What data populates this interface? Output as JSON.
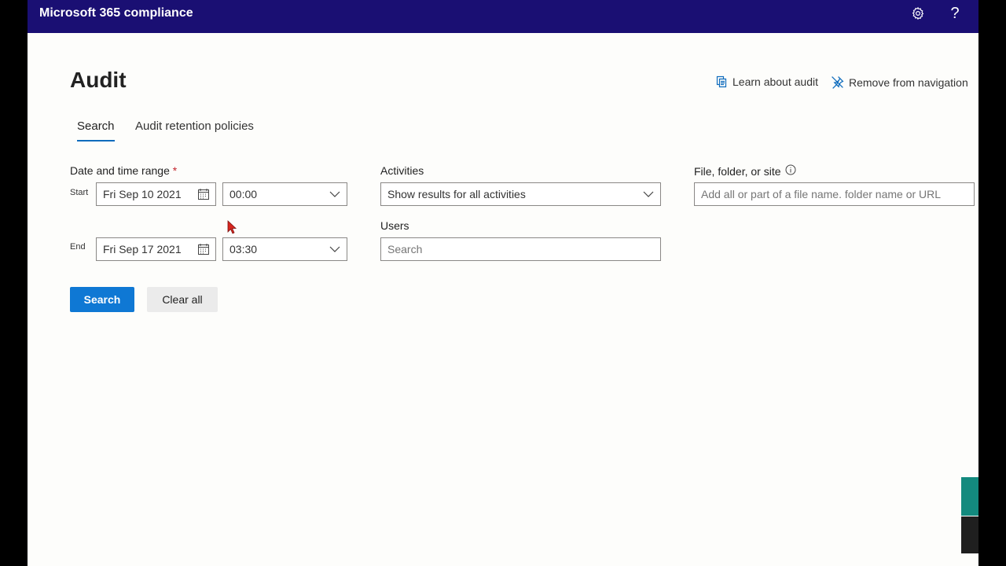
{
  "app": {
    "title": "Microsoft 365 compliance"
  },
  "page": {
    "title": "Audit"
  },
  "links": {
    "learn": "Learn about audit",
    "remove": "Remove from navigation"
  },
  "tabs": [
    {
      "label": "Search",
      "selected": true
    },
    {
      "label": "Audit retention policies",
      "selected": false
    }
  ],
  "date_range": {
    "label": "Date and time range",
    "required_mark": "*",
    "start": {
      "label": "Start",
      "date": "Fri Sep 10 2021",
      "time": "00:00"
    },
    "end": {
      "label": "End",
      "date": "Fri Sep 17 2021",
      "time": "03:30"
    }
  },
  "activities": {
    "label": "Activities",
    "value": "Show results for all activities"
  },
  "users": {
    "label": "Users",
    "placeholder": "Search"
  },
  "file": {
    "label": "File, folder, or site",
    "placeholder": "Add all or part of a file name. folder name or URL"
  },
  "buttons": {
    "search": "Search",
    "clear": "Clear all"
  },
  "colors": {
    "topbar": "#1a0f73",
    "accent": "#0f78d4",
    "required": "#c4262e"
  },
  "icons": {
    "settings": "gear-icon",
    "help": "help-icon",
    "learn": "document-icon",
    "remove": "unpin-icon",
    "calendar": "calendar-icon",
    "dropdown": "chevron-down-icon",
    "info": "info-icon"
  }
}
